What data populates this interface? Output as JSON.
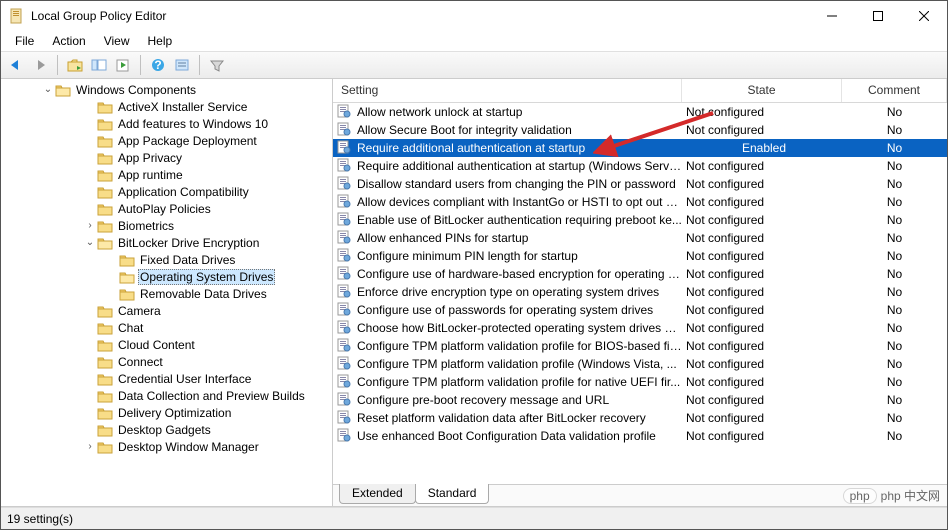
{
  "window": {
    "title": "Local Group Policy Editor"
  },
  "menu": {
    "items": [
      "File",
      "Action",
      "View",
      "Help"
    ]
  },
  "toolbar": {
    "buttons": [
      "back",
      "forward",
      "up",
      "show-hide-tree",
      "refresh",
      "export-list",
      "help",
      "policy-icon",
      "filter"
    ]
  },
  "tree": {
    "root": {
      "label": "Windows Components",
      "expanded": true
    },
    "items": [
      {
        "label": "ActiveX Installer Service",
        "indent": 1
      },
      {
        "label": "Add features to Windows 10",
        "indent": 1
      },
      {
        "label": "App Package Deployment",
        "indent": 1
      },
      {
        "label": "App Privacy",
        "indent": 1
      },
      {
        "label": "App runtime",
        "indent": 1
      },
      {
        "label": "Application Compatibility",
        "indent": 1
      },
      {
        "label": "AutoPlay Policies",
        "indent": 1
      },
      {
        "label": "Biometrics",
        "indent": 1,
        "expandable": true,
        "expanded": false
      },
      {
        "label": "BitLocker Drive Encryption",
        "indent": 1,
        "expandable": true,
        "expanded": true
      },
      {
        "label": "Fixed Data Drives",
        "indent": 2
      },
      {
        "label": "Operating System Drives",
        "indent": 2,
        "selected": true
      },
      {
        "label": "Removable Data Drives",
        "indent": 2
      },
      {
        "label": "Camera",
        "indent": 1
      },
      {
        "label": "Chat",
        "indent": 1
      },
      {
        "label": "Cloud Content",
        "indent": 1
      },
      {
        "label": "Connect",
        "indent": 1
      },
      {
        "label": "Credential User Interface",
        "indent": 1
      },
      {
        "label": "Data Collection and Preview Builds",
        "indent": 1
      },
      {
        "label": "Delivery Optimization",
        "indent": 1
      },
      {
        "label": "Desktop Gadgets",
        "indent": 1
      },
      {
        "label": "Desktop Window Manager",
        "indent": 1,
        "expandable": true,
        "expanded": false
      }
    ]
  },
  "columns": {
    "setting": "Setting",
    "state": "State",
    "comment": "Comment"
  },
  "settings": [
    {
      "name": "Allow network unlock at startup",
      "state": "Not configured",
      "comment": "No"
    },
    {
      "name": "Allow Secure Boot for integrity validation",
      "state": "Not configured",
      "comment": "No"
    },
    {
      "name": "Require additional authentication at startup",
      "state": "Enabled",
      "comment": "No",
      "selected": true
    },
    {
      "name": "Require additional authentication at startup (Windows Serve...",
      "state": "Not configured",
      "comment": "No"
    },
    {
      "name": "Disallow standard users from changing the PIN or password",
      "state": "Not configured",
      "comment": "No"
    },
    {
      "name": "Allow devices compliant with InstantGo or HSTI to opt out o...",
      "state": "Not configured",
      "comment": "No"
    },
    {
      "name": "Enable use of BitLocker authentication requiring preboot ke...",
      "state": "Not configured",
      "comment": "No"
    },
    {
      "name": "Allow enhanced PINs for startup",
      "state": "Not configured",
      "comment": "No"
    },
    {
      "name": "Configure minimum PIN length for startup",
      "state": "Not configured",
      "comment": "No"
    },
    {
      "name": "Configure use of hardware-based encryption for operating s...",
      "state": "Not configured",
      "comment": "No"
    },
    {
      "name": "Enforce drive encryption type on operating system drives",
      "state": "Not configured",
      "comment": "No"
    },
    {
      "name": "Configure use of passwords for operating system drives",
      "state": "Not configured",
      "comment": "No"
    },
    {
      "name": "Choose how BitLocker-protected operating system drives ca...",
      "state": "Not configured",
      "comment": "No"
    },
    {
      "name": "Configure TPM platform validation profile for BIOS-based fir...",
      "state": "Not configured",
      "comment": "No"
    },
    {
      "name": "Configure TPM platform validation profile (Windows Vista, ...",
      "state": "Not configured",
      "comment": "No"
    },
    {
      "name": "Configure TPM platform validation profile for native UEFI fir...",
      "state": "Not configured",
      "comment": "No"
    },
    {
      "name": "Configure pre-boot recovery message and URL",
      "state": "Not configured",
      "comment": "No"
    },
    {
      "name": "Reset platform validation data after BitLocker recovery",
      "state": "Not configured",
      "comment": "No"
    },
    {
      "name": "Use enhanced Boot Configuration Data validation profile",
      "state": "Not configured",
      "comment": "No"
    }
  ],
  "tabs": {
    "extended": "Extended",
    "standard": "Standard"
  },
  "status": {
    "text": "19 setting(s)"
  },
  "watermark": {
    "text": "php 中文网"
  }
}
